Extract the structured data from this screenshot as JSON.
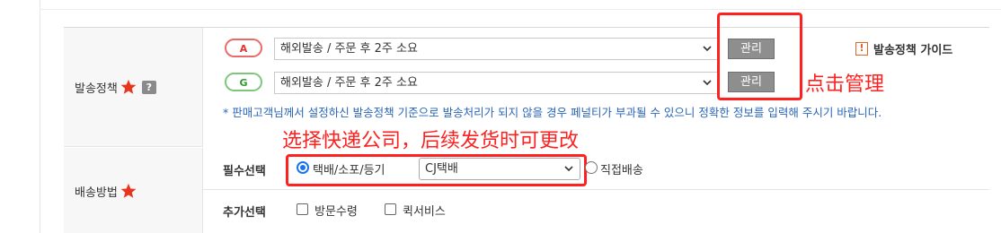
{
  "shipping_policy": {
    "label": "발송정책",
    "help": "?",
    "option_a": {
      "badge": "A",
      "value": "해외발송 / 주문 후 2주 소요",
      "manage_label": "관리"
    },
    "option_g": {
      "badge": "G",
      "value": "해외발송 / 주문 후 2주 소요",
      "manage_label": "관리"
    },
    "guide": {
      "warn": "!",
      "label": "발송정책 가이드"
    },
    "notice": "* 판매고객님께서 설정하신 발송정책 기준으로 발송처리가 되지 않을 경우 페널티가 부과될 수 있으니 정확한 정보를 입력해 주시기 바랍니다."
  },
  "delivery_method": {
    "label": "배송방법",
    "required_label": "필수선택",
    "parcel_option": "택배/소포/등기",
    "courier_value": "CJ택배",
    "direct_option": "직접배송",
    "additional_label": "추가선택",
    "visit_pickup": "방문수령",
    "quick_service": "퀵서비스"
  },
  "annotations": {
    "manage_hint": "点击管理",
    "courier_hint": "选择快递公司，后续发货时可更改"
  },
  "colors": {
    "annotation": "#ff2020",
    "notice": "#2a66b8",
    "star": "#e8361e",
    "radio_accent": "#1a73e8"
  }
}
